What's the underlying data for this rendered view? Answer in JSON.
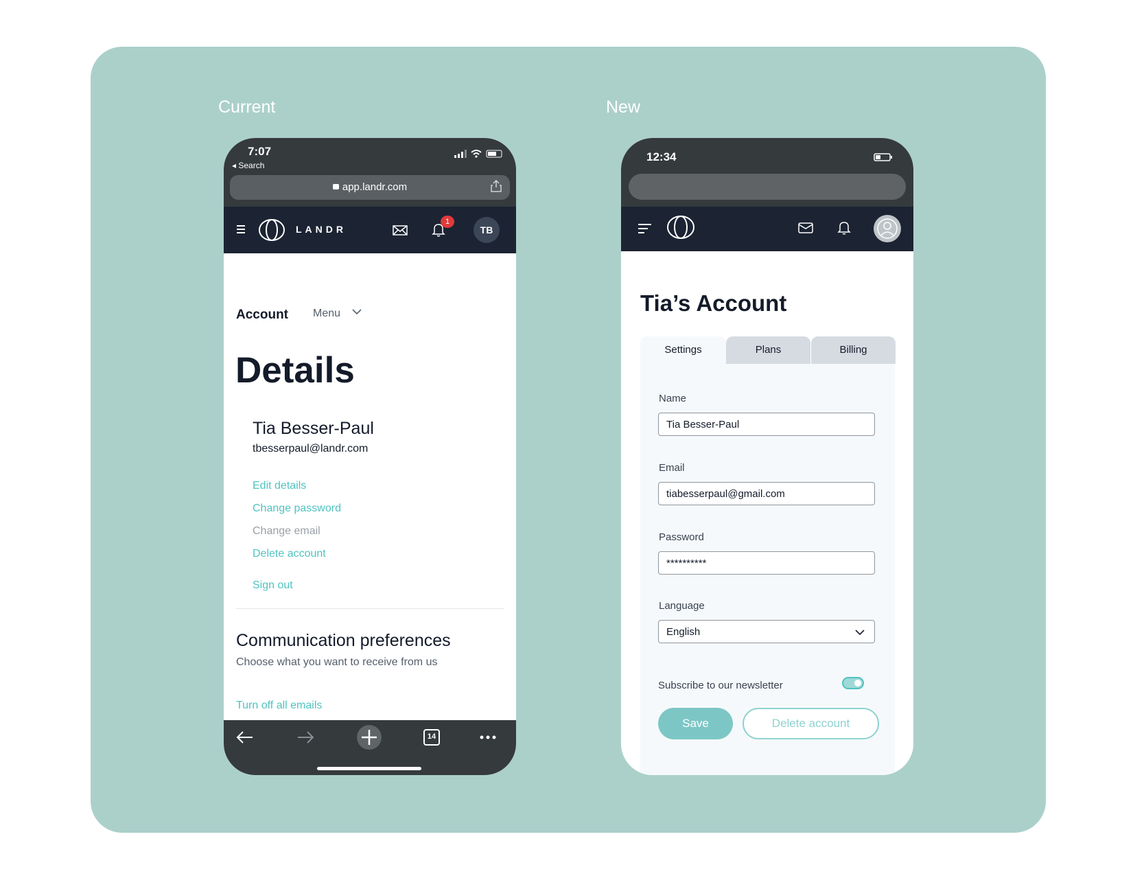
{
  "labels": {
    "current": "Current",
    "new": "New"
  },
  "old": {
    "status": {
      "time": "7:07",
      "back": "◂ Search"
    },
    "url": "app.landr.com",
    "brand": "LANDR",
    "notification_count": "1",
    "avatar_initials": "TB",
    "account_label": "Account",
    "menu_label": "Menu",
    "page_title": "Details",
    "user_name": "Tia Besser-Paul",
    "user_email": "tbesserpaul@landr.com",
    "links": {
      "edit_details": "Edit details",
      "change_password": "Change password",
      "change_email": "Change email",
      "delete_account": "Delete account",
      "sign_out": "Sign out"
    },
    "comm_title": "Communication preferences",
    "comm_subtitle": "Choose what you want to receive from us",
    "turn_off": "Turn off all emails",
    "tab_count": "14"
  },
  "new": {
    "status": {
      "time": "12:34"
    },
    "title": "Tia’s Account",
    "tabs": [
      "Settings",
      "Plans",
      "Billing"
    ],
    "fields": {
      "name_label": "Name",
      "name_value": "Tia Besser-Paul",
      "email_label": "Email",
      "email_value": "tiabesserpaul@gmail.com",
      "password_label": "Password",
      "password_value": "**********",
      "language_label": "Language",
      "language_value": "English"
    },
    "newsletter_label": "Subscribe to our newsletter",
    "newsletter_on": true,
    "save_label": "Save",
    "delete_label": "Delete account"
  },
  "colors": {
    "accent": "#4fc3c1",
    "appbar": "#1c2433",
    "panel": "#abd0ca",
    "badge": "#e03a3a"
  }
}
